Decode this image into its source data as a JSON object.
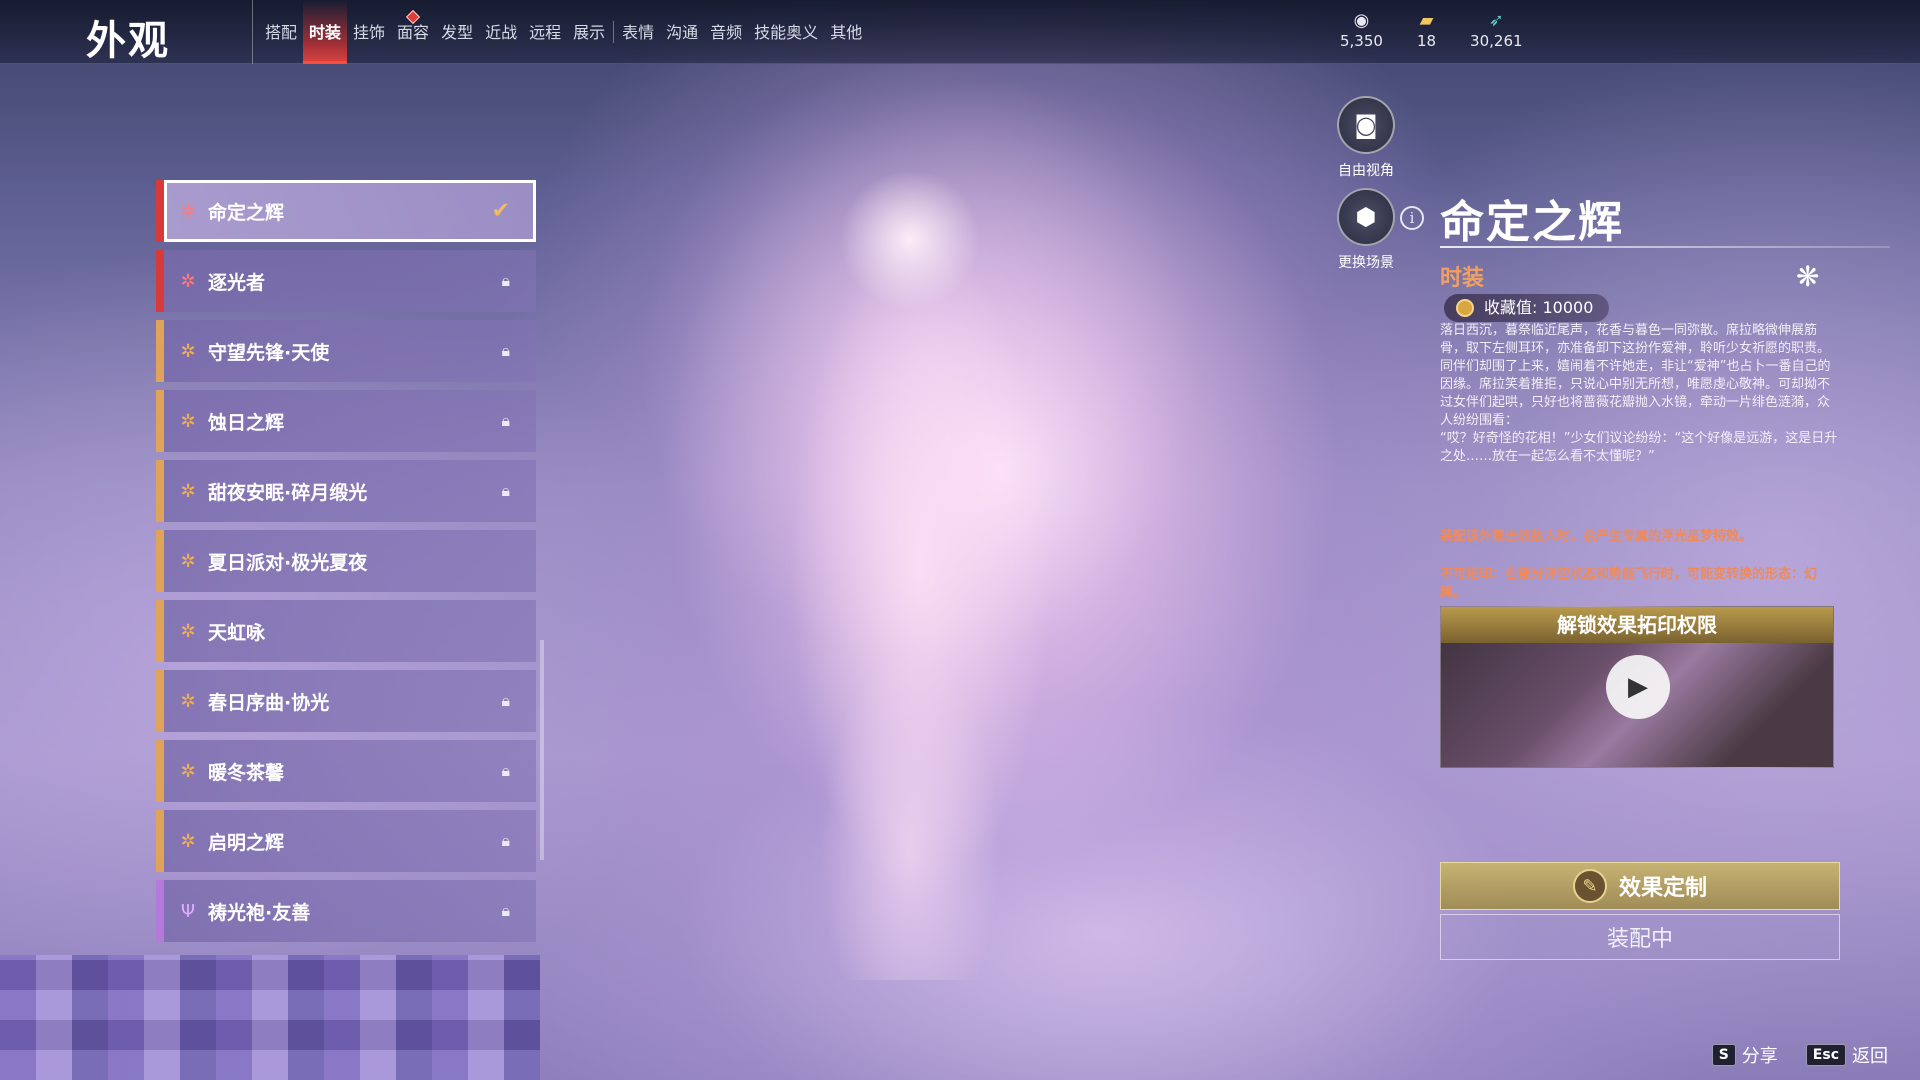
{
  "header": {
    "title": "外观",
    "tabs": [
      {
        "label": "搭配"
      },
      {
        "label": "时装",
        "active": true
      },
      {
        "label": "挂饰"
      },
      {
        "label": "面容",
        "notice": true
      },
      {
        "label": "发型"
      },
      {
        "label": "近战"
      },
      {
        "label": "远程"
      },
      {
        "label": "展示"
      },
      {
        "label": "表情"
      },
      {
        "label": "沟通"
      },
      {
        "label": "音频"
      },
      {
        "label": "技能奥义"
      },
      {
        "label": "其他"
      }
    ],
    "currencies": [
      {
        "icon": "gem-currency-icon",
        "value": "5,350"
      },
      {
        "icon": "ticket-currency-icon",
        "value": "18"
      },
      {
        "icon": "feather-currency-icon",
        "value": "30,261"
      }
    ]
  },
  "outfit_list": [
    {
      "name": "命定之辉",
      "rarity": "red",
      "status": "selected"
    },
    {
      "name": "逐光者",
      "rarity": "red",
      "status": "locked"
    },
    {
      "name": "守望先锋·天使",
      "rarity": "gold",
      "status": "locked"
    },
    {
      "name": "蚀日之辉",
      "rarity": "gold",
      "status": "locked"
    },
    {
      "name": "甜夜安眠·碎月缎光",
      "rarity": "gold",
      "status": "locked"
    },
    {
      "name": "夏日派对·极光夏夜",
      "rarity": "gold",
      "status": "none"
    },
    {
      "name": "天虹咏",
      "rarity": "gold",
      "status": "none"
    },
    {
      "name": "春日序曲·协光",
      "rarity": "gold",
      "status": "locked"
    },
    {
      "name": "暖冬茶馨",
      "rarity": "gold",
      "status": "locked"
    },
    {
      "name": "启明之辉",
      "rarity": "gold",
      "status": "locked"
    },
    {
      "name": "祷光袍·友善",
      "rarity": "purple",
      "status": "locked"
    }
  ],
  "camera": {
    "free_view": "自由视角",
    "change_scene": "更换场景"
  },
  "detail": {
    "title": "命定之辉",
    "category": "时装",
    "collection": "收藏值: 10000",
    "description_1": "落日西沉，暮祭临近尾声，花香与暮色一同弥散。席拉略微伸展筋骨，取下左侧耳环，亦准备卸下这扮作爱神，聆听少女祈愿的职责。",
    "description_2": "同伴们却围了上来，嬉闹着不许她走，非让“爱神”也占卜一番自己的因缘。席拉笑着推拒，只说心中别无所想，唯愿虔心敬神。可却拗不过女伴们起哄，只好也将蔷薇花瓣抛入水镜，牵动一片绯色涟漪，众人纷纷围看：",
    "description_3": "“哎？好奇怪的花相！”少女们议论纷纷：“这个好像是远游，这是日升之处……放在一起怎么看不太懂呢？”",
    "effect_note": "装配该外观击败敌人时，会产生专属的浮光星梦特效。",
    "imprint_note": "不可拓印：在部分浮空状态和势能飞行时，可能变转换的形态：幻翼。",
    "unlock_title": "解锁效果拓印权限",
    "effect_button": "效果定制",
    "equip_button": "装配中"
  },
  "hints": [
    {
      "key": "S",
      "label": "分享"
    },
    {
      "key": "Esc",
      "label": "返回"
    }
  ],
  "colors": {
    "active_tab": "#e8463a",
    "rarity_red": "#d83a3a",
    "rarity_gold": "#e0a35a",
    "rarity_purple": "#b57ad9",
    "accent_orange": "#f08a5a"
  }
}
